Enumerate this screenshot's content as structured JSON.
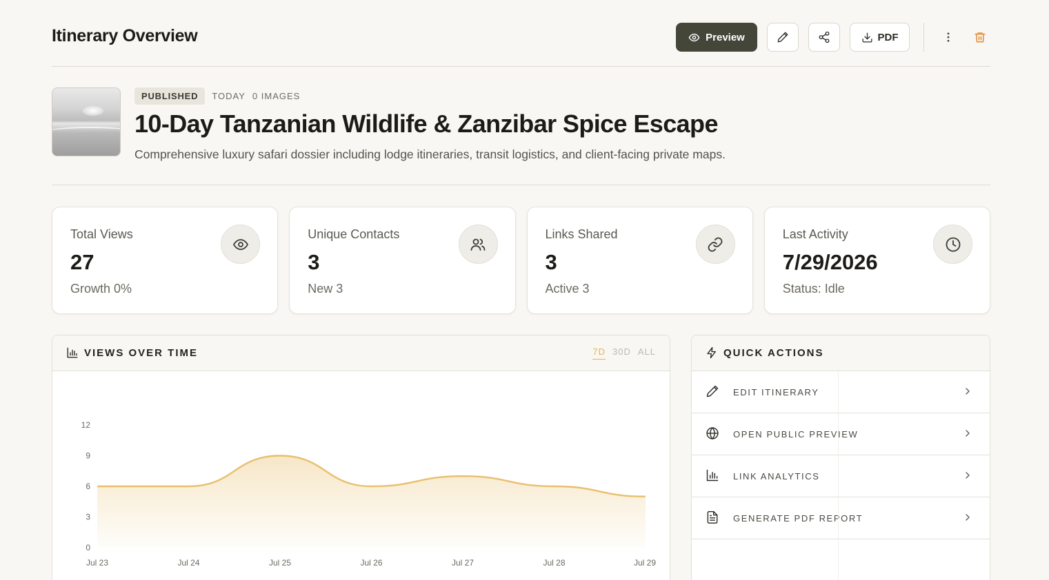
{
  "header": {
    "title": "Itinerary Overview",
    "preview_label": "Preview",
    "pdf_label": "PDF",
    "icons": [
      "eye-icon",
      "pencil-icon",
      "share-icon",
      "download-icon",
      "more-vertical-icon",
      "trash-icon"
    ]
  },
  "hero": {
    "status_badge": "PUBLISHED",
    "date": "TODAY",
    "images_count": "0 IMAGES",
    "title": "10-Day Tanzanian Wildlife & Zanzibar Spice Escape",
    "subtitle": "Comprehensive luxury safari dossier including lodge itineraries, transit logistics, and client-facing private maps."
  },
  "stats": [
    {
      "label": "Total Views",
      "value": "27",
      "sub": "Growth 0%",
      "icon": "eye-icon"
    },
    {
      "label": "Unique Contacts",
      "value": "3",
      "sub": "New 3",
      "icon": "users-icon"
    },
    {
      "label": "Links Shared",
      "value": "3",
      "sub": "Active 3",
      "icon": "link-icon"
    },
    {
      "label": "Last Activity",
      "value": "7/29/2026",
      "sub": "Status: Idle",
      "icon": "clock-icon"
    }
  ],
  "views_panel": {
    "title": "VIEWS OVER TIME",
    "ranges": [
      "7D",
      "30D",
      "ALL"
    ],
    "active_range": "7D"
  },
  "chart_data": {
    "type": "area",
    "categories": [
      "Jul 23",
      "Jul 24",
      "Jul 25",
      "Jul 26",
      "Jul 27",
      "Jul 28",
      "Jul 29"
    ],
    "values": [
      6,
      6,
      9,
      6,
      7,
      6,
      5
    ],
    "yticks": [
      "0",
      "3",
      "6",
      "9",
      "12"
    ],
    "ylim": [
      0,
      12
    ],
    "grid": false,
    "color": "#e8bf6d"
  },
  "quick_actions": {
    "title": "QUICK ACTIONS",
    "items": [
      {
        "label": "EDIT ITINERARY",
        "icon": "pencil-icon"
      },
      {
        "label": "OPEN PUBLIC PREVIEW",
        "icon": "globe-icon"
      },
      {
        "label": "LINK ANALYTICS",
        "icon": "bar-chart-icon"
      },
      {
        "label": "GENERATE PDF REPORT",
        "icon": "file-text-icon"
      }
    ]
  },
  "colors": {
    "background": "#f8f7f3",
    "primary_button": "#44463a",
    "accent": "#e6b15a",
    "danger": "#e58a2f"
  }
}
